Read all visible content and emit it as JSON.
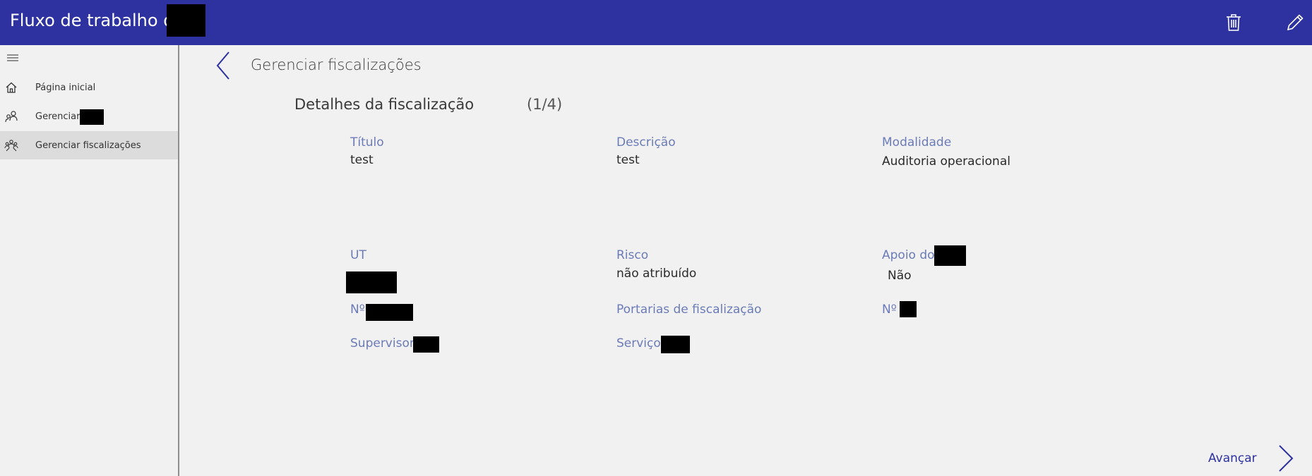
{
  "header": {
    "title": "Fluxo de trabalho do",
    "delete_icon": "trash-icon",
    "edit_icon": "pencil-icon",
    "color": "#2d32a0"
  },
  "sidebar": {
    "menu_icon": "hamburger-icon",
    "items": [
      {
        "label": "Página inicial",
        "icon": "home-icon",
        "active": false
      },
      {
        "label": "Gerenciar",
        "icon": "people-icon",
        "active": false
      },
      {
        "label": "Gerenciar fiscalizações",
        "icon": "group-icon",
        "active": true
      }
    ]
  },
  "main": {
    "title": "Gerenciar fiscalizações",
    "subtitle": "Detalhes da fiscalização",
    "page_counter": "(1/4)",
    "fields": {
      "titulo": {
        "label": "Título",
        "value": "test"
      },
      "descricao": {
        "label": "Descrição",
        "value": "test"
      },
      "modalidade": {
        "label": "Modalidade",
        "value": "Auditoria operacional"
      },
      "ut": {
        "label": "UT"
      },
      "risco": {
        "label": "Risco",
        "value": "não atribuído"
      },
      "apoio": {
        "label": "Apoio do",
        "value": "Não"
      },
      "numero1": {
        "label": "Nº"
      },
      "portarias": {
        "label": "Portarias de fiscalização"
      },
      "numero2": {
        "label": "Nº"
      },
      "supervisor": {
        "label": "Supervisor"
      },
      "servico": {
        "label": "Serviço"
      }
    },
    "next_label": "Avançar"
  }
}
